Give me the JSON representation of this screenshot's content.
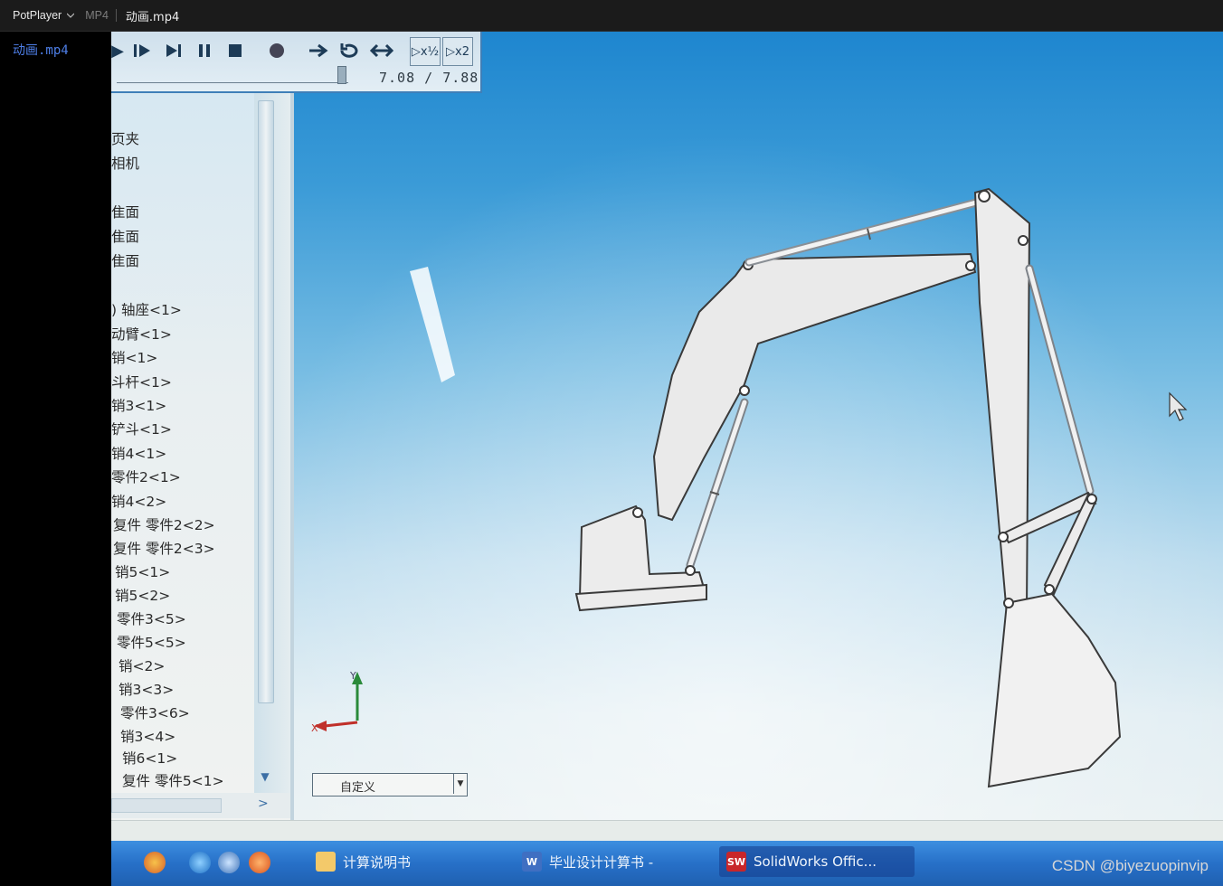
{
  "titlebar": {
    "app_name": "PotPlayer",
    "format_label": "MP4",
    "file_name": "动画.mp4"
  },
  "playlist": {
    "items": [
      "动画.mp4"
    ]
  },
  "video_content": {
    "toolbar": {
      "time": "7.08 / 7.88",
      "speed_half": "▷x½",
      "speed_double": "▷x2"
    },
    "feature_tree": [
      "页夹",
      "相机",
      "隹面",
      "隹面",
      "隹面",
      ")  轴座<1>",
      "动臂<1>",
      "销<1>",
      "斗杆<1>",
      "销3<1>",
      "铲斗<1>",
      "销4<1>",
      "零件2<1>",
      "销4<2>",
      "复件  零件2<2>",
      "复件  零件2<3>",
      "销5<1>",
      "销5<2>",
      "零件3<5>",
      "零件5<5>",
      "销<2>",
      "销3<3>",
      "零件3<6>",
      "销3<4>",
      "销6<1>",
      "复件  零件5<1>"
    ],
    "axis": {
      "x": "X",
      "y": "Y"
    },
    "view_dropdown": "自定义",
    "taskbar": [
      {
        "label": "计算说明书",
        "icon": "folder-icon"
      },
      {
        "label": "毕业设计计算书 -",
        "icon": "word-icon"
      },
      {
        "label": "SolidWorks Offic...",
        "icon": "solidworks-icon"
      }
    ],
    "colors": {
      "sky_top": "#1e86cf",
      "sky_bottom": "#eef3f3",
      "taskbar": "#2770c8"
    }
  },
  "watermark": "CSDN @biyezuopinvip"
}
